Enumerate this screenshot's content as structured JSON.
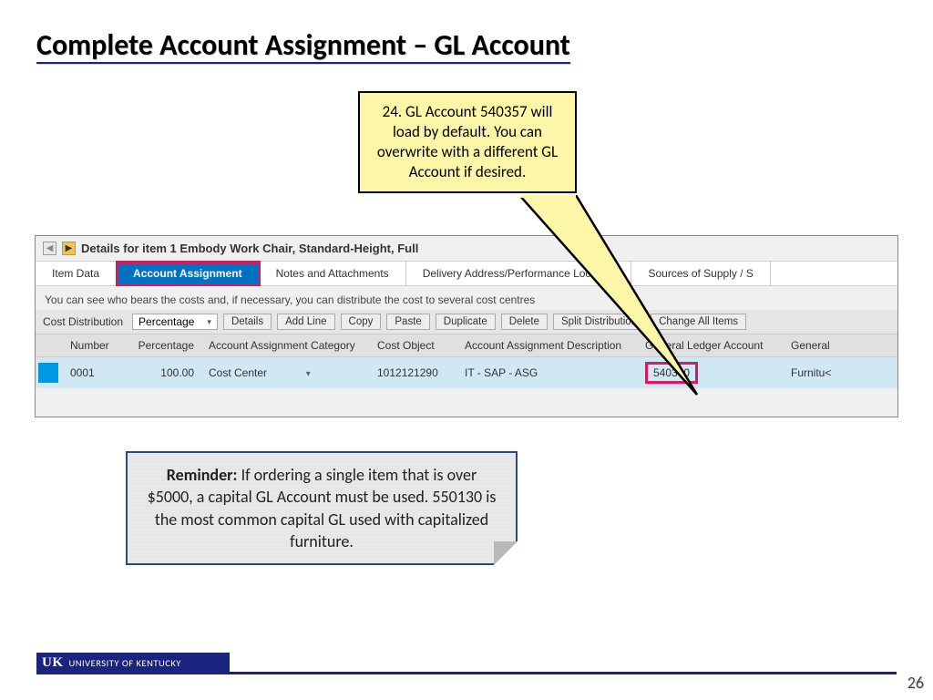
{
  "title": "Complete Account Assignment – GL Account",
  "callout": "24. GL Account 540357 will load by default. You can overwrite with a different GL Account if desired.",
  "sap": {
    "header": "Details for item 1  Embody Work Chair, Standard-Height, Full",
    "tabs": [
      "Item Data",
      "Account Assignment",
      "Notes and Attachments",
      "Delivery Address/Performance Location",
      "Sources of Supply / S"
    ],
    "help": "You can see who bears the costs and, if necessary, you can distribute the cost to several cost centres",
    "toolbar": {
      "dist_label": "Cost Distribution",
      "dist_value": "Percentage",
      "buttons": [
        "Details",
        "Add Line",
        "Copy",
        "Paste",
        "Duplicate",
        "Delete",
        "Split Distribution",
        "Change All Items"
      ]
    },
    "cols": [
      "Number",
      "Percentage",
      "Account Assignment Category",
      "Cost Object",
      "Account Assignment Description",
      "General Ledger Account",
      "General"
    ],
    "row": {
      "number": "0001",
      "percentage": "100.00",
      "category": "Cost Center",
      "cost_object": "1012121290",
      "desc": "IT - SAP - ASG",
      "gl": "540300",
      "gen": "Furnitu<"
    }
  },
  "reminder": {
    "label": "Reminder:",
    "text": " If ordering a single item that is over $5000, a capital GL Account must be used. 550130 is the most common capital GL used with capitalized furniture."
  },
  "footer": {
    "logo_mark": "UK",
    "logo_text": "UNIVERSITY OF KENTUCKY"
  },
  "page": "26"
}
